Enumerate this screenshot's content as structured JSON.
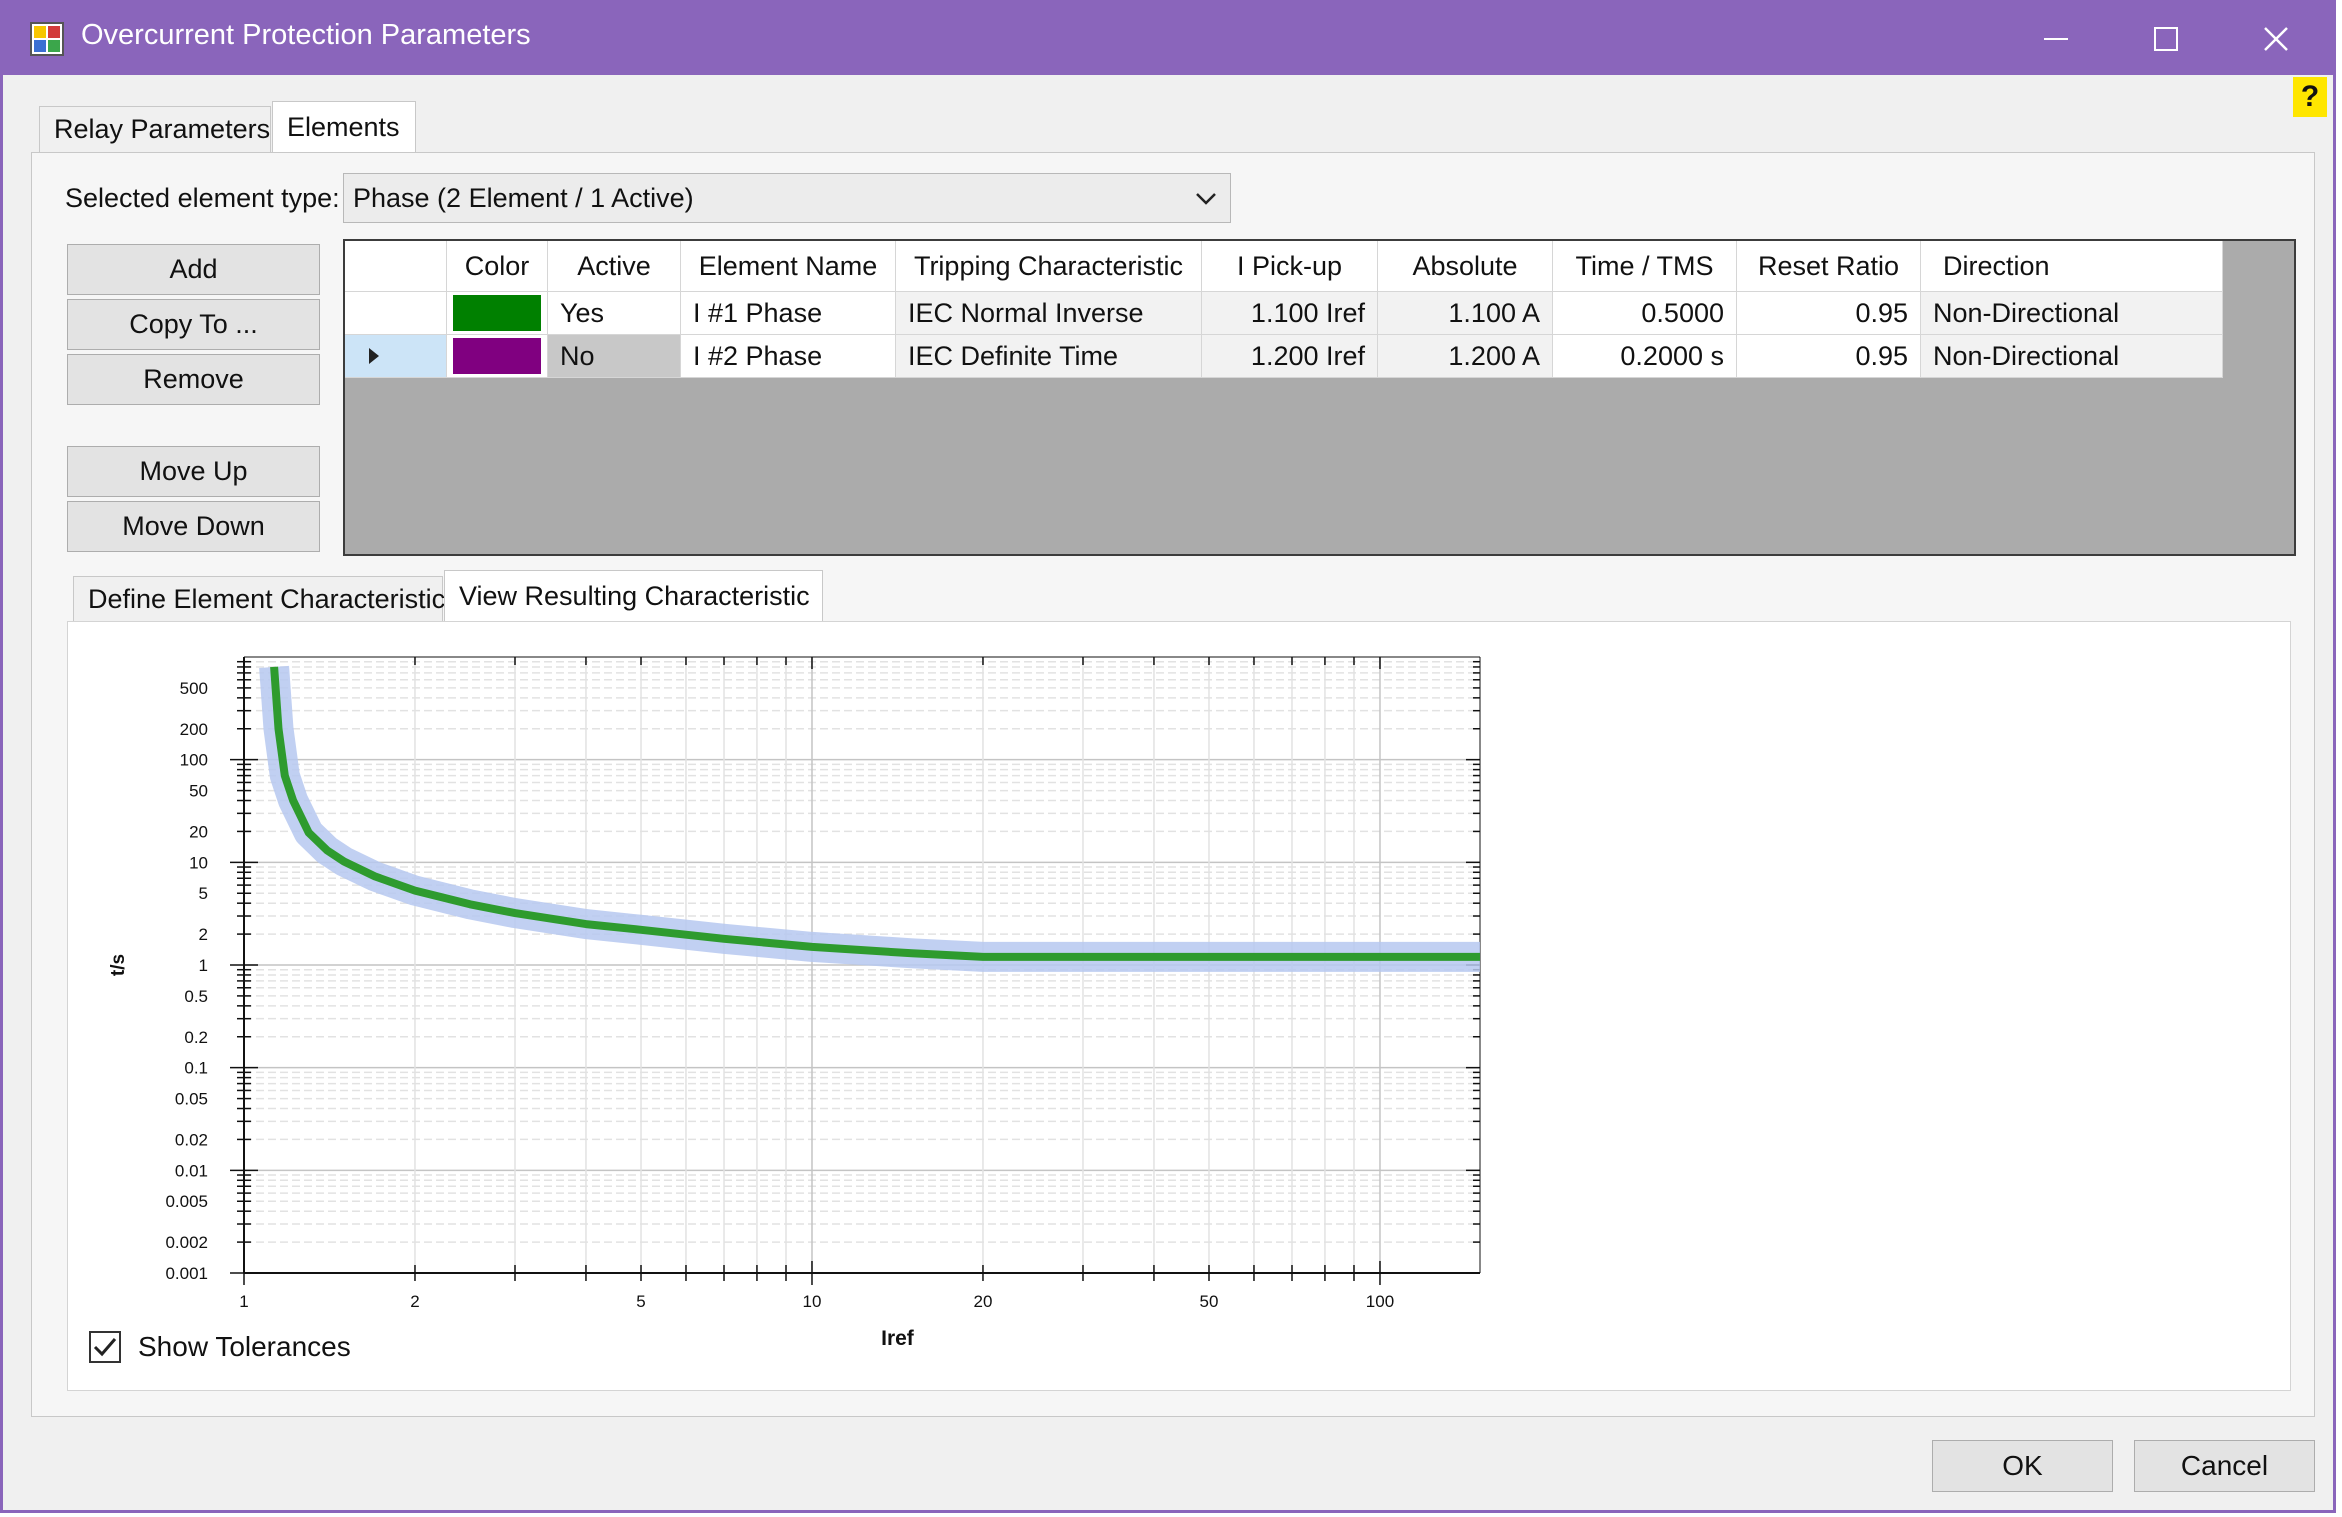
{
  "window": {
    "title": "Overcurrent Protection Parameters",
    "help_label": "?",
    "accent_color": "#8a65bb"
  },
  "tabs": [
    {
      "label": "Relay Parameters",
      "active": false
    },
    {
      "label": "Elements",
      "active": true
    }
  ],
  "element_type": {
    "label": "Selected element type:",
    "value": "Phase (2 Element / 1 Active)"
  },
  "buttons": {
    "add": "Add",
    "copy": "Copy To ...",
    "remove": "Remove",
    "move_up": "Move Up",
    "move_down": "Move Down"
  },
  "table": {
    "columns": [
      "",
      "Color",
      "Active",
      "Element Name",
      "Tripping Characteristic",
      "I Pick-up",
      "Absolute",
      "Time / TMS",
      "Reset Ratio",
      "Direction"
    ],
    "rows": [
      {
        "selected": false,
        "color": "#008000",
        "active": "Yes",
        "name": "I #1 Phase",
        "characteristic": "IEC Normal Inverse",
        "pickup": "1.100 Iref",
        "absolute": "1.100 A",
        "time": "0.5000",
        "reset": "0.95",
        "direction": "Non-Directional"
      },
      {
        "selected": true,
        "color": "#800080",
        "active": "No",
        "name": "I #2 Phase",
        "characteristic": "IEC Definite Time",
        "pickup": "1.200 Iref",
        "absolute": "1.200 A",
        "time": "0.2000 s",
        "reset": "0.95",
        "direction": "Non-Directional"
      }
    ]
  },
  "sub_tabs": [
    {
      "label": "Define Element Characteristic",
      "active": false
    },
    {
      "label": "View Resulting Characteristic",
      "active": true
    }
  ],
  "show_tolerances": {
    "label": "Show Tolerances",
    "checked": true
  },
  "dialog": {
    "ok": "OK",
    "cancel": "Cancel"
  },
  "chart_data": {
    "type": "line",
    "xlabel": "Iref",
    "ylabel": "t/s",
    "x_scale": "log",
    "y_scale": "log",
    "xlim": [
      1,
      150
    ],
    "ylim": [
      0.001,
      1000
    ],
    "x_ticks": [
      "1",
      "2",
      "5",
      "10",
      "20",
      "50",
      "100"
    ],
    "x_tick_values": [
      1,
      2,
      5,
      10,
      20,
      50,
      100
    ],
    "y_ticks": [
      "500",
      "200",
      "100",
      "50",
      "20",
      "10",
      "5",
      "2",
      "1",
      "0.5",
      "0.2",
      "0.1",
      "0.05",
      "0.02",
      "0.01",
      "0.005",
      "0.002",
      "0.001"
    ],
    "y_tick_values": [
      500,
      200,
      100,
      50,
      20,
      10,
      5,
      2,
      1,
      0.5,
      0.2,
      0.1,
      0.05,
      0.02,
      0.01,
      0.005,
      0.002,
      0.001
    ],
    "grid": true,
    "series": [
      {
        "color": "#2e9b2e",
        "tolerance_color": "#b6c8f0",
        "x": [
          1.13,
          1.15,
          1.18,
          1.22,
          1.3,
          1.4,
          1.5,
          1.7,
          2,
          2.5,
          3,
          4,
          5,
          7,
          10,
          15,
          20,
          30,
          50,
          100,
          150
        ],
        "y": [
          800,
          200,
          70,
          40,
          19.5,
          13.1,
          10.2,
          7.3,
          5.3,
          3.9,
          3.2,
          2.5,
          2.2,
          1.8,
          1.5,
          1.3,
          1.2,
          1.2,
          1.2,
          1.2,
          1.2
        ]
      }
    ]
  }
}
